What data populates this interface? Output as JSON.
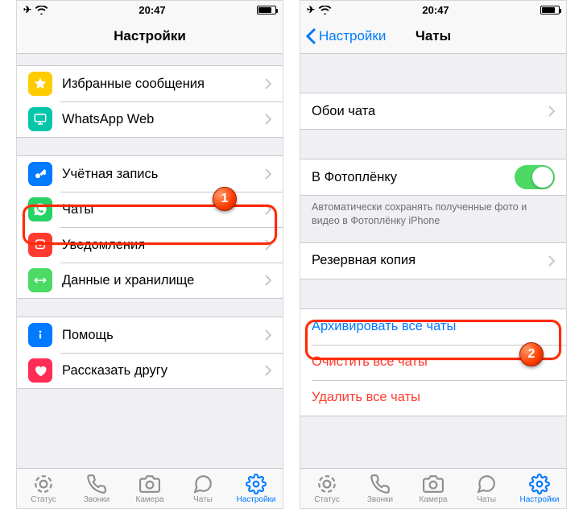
{
  "status": {
    "time": "20:47"
  },
  "left": {
    "title": "Настройки",
    "groups": [
      [
        {
          "icon": "star",
          "color": "#ffcc00",
          "label": "Избранные сообщения"
        },
        {
          "icon": "monitor",
          "color": "#07c5a8",
          "label": "WhatsApp Web"
        }
      ],
      [
        {
          "icon": "key",
          "color": "#007aff",
          "label": "Учётная запись"
        },
        {
          "icon": "whatsapp",
          "color": "#25d366",
          "label": "Чаты"
        },
        {
          "icon": "bell",
          "color": "#ff3b30",
          "label": "Уведомления"
        },
        {
          "icon": "swap",
          "color": "#4cd964",
          "label": "Данные и хранилище"
        }
      ],
      [
        {
          "icon": "info",
          "color": "#007aff",
          "label": "Помощь"
        },
        {
          "icon": "heart",
          "color": "#ff2d55",
          "label": "Рассказать другу"
        }
      ]
    ]
  },
  "right": {
    "back": "Настройки",
    "title": "Чаты",
    "wallpaper": "Обои чата",
    "save_toggle": "В Фотоплёнку",
    "save_note": "Автоматически сохранять полученные фото и видео в Фотоплёнку iPhone",
    "backup": "Резервная копия",
    "archive": "Архивировать все чаты",
    "clear": "Очистить все чаты",
    "delete": "Удалить все чаты"
  },
  "tabs": [
    {
      "id": "status",
      "label": "Статус"
    },
    {
      "id": "calls",
      "label": "Звонки"
    },
    {
      "id": "camera",
      "label": "Камера"
    },
    {
      "id": "chats",
      "label": "Чаты"
    },
    {
      "id": "settings",
      "label": "Настройки"
    }
  ],
  "markers": {
    "one": "1",
    "two": "2"
  }
}
